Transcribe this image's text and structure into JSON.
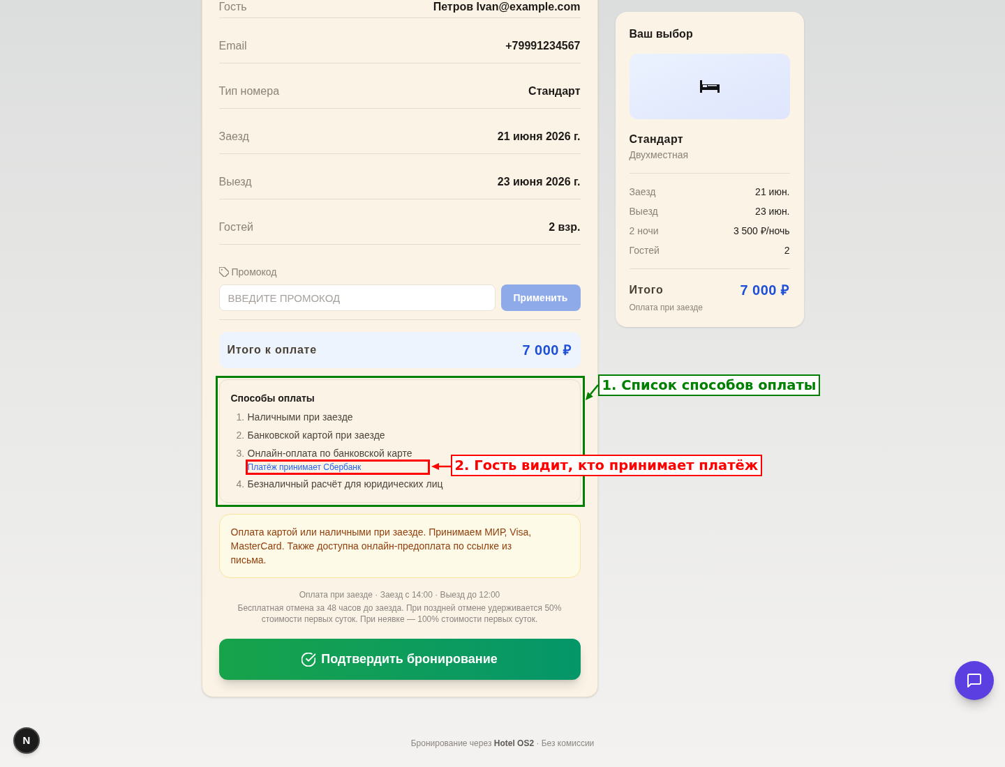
{
  "booking_details": {
    "rows": [
      {
        "label": "Гость",
        "value": "Петров Ivan@example.com"
      },
      {
        "label": "Email",
        "value": "+79991234567"
      },
      {
        "label": "Тип номера",
        "value": "Стандарт"
      },
      {
        "label": "Заезд",
        "value": "21 июня 2026 г."
      },
      {
        "label": "Выезд",
        "value": "23 июня 2026 г."
      },
      {
        "label": "Гостей",
        "value": "2 взр."
      }
    ]
  },
  "promo": {
    "label": "Промокод",
    "placeholder": "ВВЕДИТЕ ПРОМОКОД",
    "button": {
      "label": "Применить",
      "disabled": true
    }
  },
  "total": {
    "label": "Итого к оплате",
    "amount": "7 000 ₽"
  },
  "payment_methods": {
    "title": "Способы оплаты",
    "items": [
      {
        "number": "1.",
        "label": "Наличными при заезде"
      },
      {
        "number": "2.",
        "label": "Банковской картой при заезде"
      },
      {
        "number": "3.",
        "label": "Онлайн-оплата по банковской карте",
        "note": "Платёж принимает Сбербанк"
      },
      {
        "number": "4.",
        "label": "Безналичный расчёт для юридических лиц"
      }
    ]
  },
  "payment_notice": "Оплата картой или наличными при заезде. Принимаем МИР, Visa, MasterCard. Также доступна онлайн-предоплата по ссылке из письма.",
  "policy": {
    "summary": "Оплата при заезде · Заезд с 14:00 · Выезд до 12:00",
    "cancellation": "Бесплатная отмена за 48 часов до заезда. При поздней отмене удерживается 50% стоимости первых суток. При неявке — 100% стоимости первых суток."
  },
  "confirm_button": {
    "label": "Подтвердить бронирование"
  },
  "summary_card": {
    "title": "Ваш выбор",
    "room_name": "Стандарт",
    "room_type": "Двухместная",
    "rows": [
      {
        "label": "Заезд",
        "value": "21 июн."
      },
      {
        "label": "Выезд",
        "value": "23 июн."
      },
      {
        "label": "2 ночи",
        "value": "3 500 ₽/ночь"
      },
      {
        "label": "Гостей",
        "value": "2"
      }
    ],
    "total_label": "Итого",
    "total_amount": "7 000 ₽",
    "payment_note": "Оплата при заезде"
  },
  "footer": "Бронирование через **Hotel OS2** · Без комиссии",
  "dev_badge": {
    "label": "N"
  },
  "annotations": [
    {
      "label": "1. Список способов оплаты",
      "color": "#008000"
    },
    {
      "label": "2. Гость видит, кто принимает платёж",
      "color": "#ff0000"
    }
  ]
}
